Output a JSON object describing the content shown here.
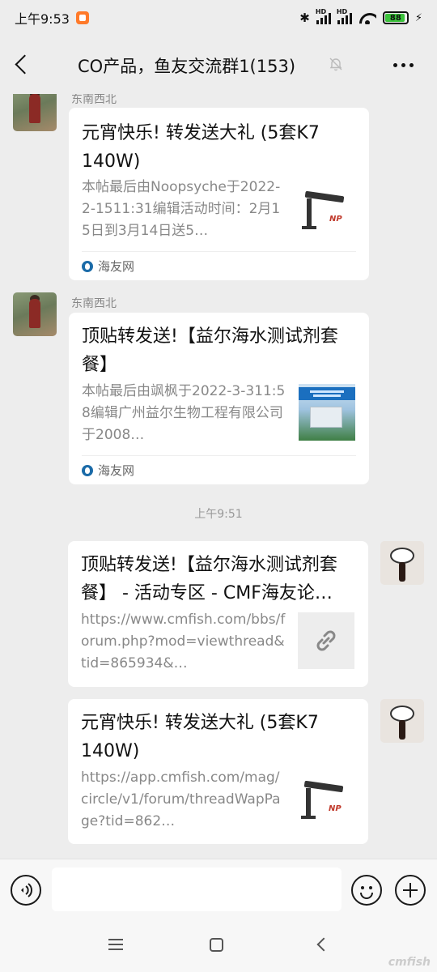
{
  "status_bar": {
    "time": "上午9:53",
    "signal_label": "HD",
    "battery_level": "88"
  },
  "header": {
    "title": "CO产品，鱼友交流群1(153)"
  },
  "messages": [
    {
      "sender": "东南西北",
      "title": "元宵快乐! 转发送大礼 (5套K7 140W)",
      "desc": "本帖最后由Noopsyche于2022-2-1511:31编辑活动时间：2月15日到3月14日送5…",
      "source": "海友网"
    },
    {
      "sender": "东南西北",
      "title": "顶贴转发送!【益尔海水测试剂套餐】",
      "desc": "本帖最后由飒枫于2022-3-311:58编辑广州益尔生物工程有限公司于2008…",
      "source": "海友网"
    },
    {
      "title": "顶贴转发送!【益尔海水测试剂套餐】 - 活动专区 - CMF海友论…",
      "desc": "https://www.cmfish.com/bbs/forum.php?mod=viewthread&tid=865934&…"
    },
    {
      "title": "元宵快乐! 转发送大礼 (5套K7 140W)",
      "desc": "https://app.cmfish.com/mag/circle/v1/forum/threadWapPage?tid=862…"
    }
  ],
  "time_separator": "上午9:51",
  "thumb_logo": "NP",
  "input": {
    "placeholder": ""
  },
  "watermark": "cmfish"
}
